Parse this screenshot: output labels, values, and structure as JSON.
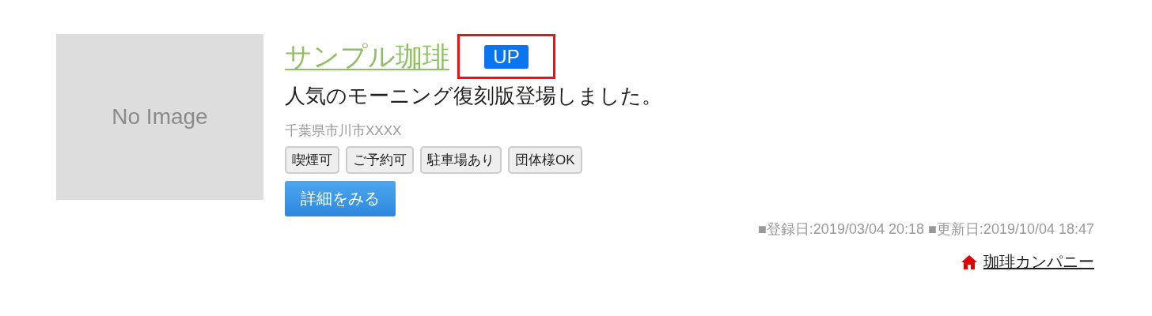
{
  "thumbnail": {
    "label": "No Image"
  },
  "title": {
    "text": "サンプル珈琲",
    "badge": "UP",
    "highlighted": true
  },
  "description": "人気のモーニング復刻版登場しました。",
  "address": "千葉県市川市XXXX",
  "tags": [
    "喫煙可",
    "ご予約可",
    "駐車場あり",
    "団体様OK"
  ],
  "detail_button": "詳細をみる",
  "dates": "■登録日:2019/03/04 20:18 ■更新日:2019/10/04 18:47",
  "company_link": "珈琲カンパニー"
}
